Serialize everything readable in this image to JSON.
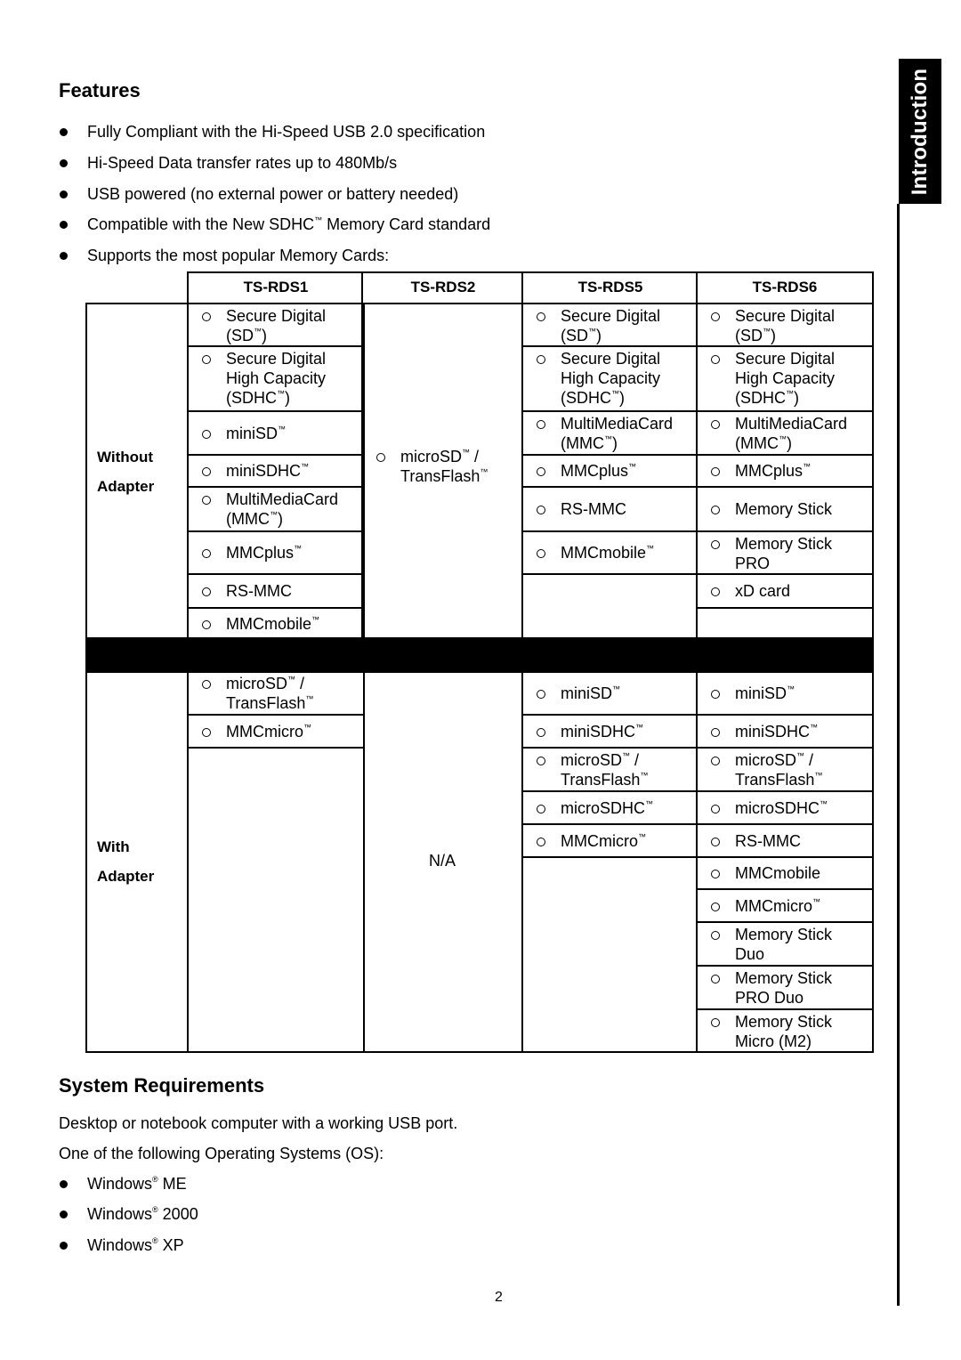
{
  "side_tab": {
    "label": "Introduction"
  },
  "features": {
    "title": "Features",
    "bullets": [
      "Fully Compliant with the Hi-Speed USB 2.0 specification",
      "Hi-Speed Data transfer rates up to 480Mb/s",
      "USB powered (no external power or battery needed)",
      "Compatible with the New SDHC™ Memory Card standard",
      "Supports the most popular Memory Cards:"
    ]
  },
  "table": {
    "headers": [
      "TS-RDS1",
      "TS-RDS2",
      "TS-RDS5",
      "TS-RDS6"
    ],
    "without_adapter": {
      "label_line1": "Without",
      "label_line2": "Adapter",
      "rds1": [
        "Secure Digital (SD™)",
        "Secure Digital High Capacity (SDHC™)",
        "miniSD™",
        "miniSDHC™",
        "MultiMediaCard (MMC™)",
        "MMCplus™",
        "RS-MMC",
        "MMCmobile™"
      ],
      "rds2": [
        "microSD™ / TransFlash™"
      ],
      "rds5": [
        "Secure Digital (SD™)",
        "Secure Digital High Capacity (SDHC™)",
        "MultiMediaCard (MMC™)",
        "MMCplus™",
        "RS-MMC",
        "MMCmobile™"
      ],
      "rds6": [
        "Secure Digital (SD™)",
        "Secure Digital High Capacity (SDHC™)",
        "MultiMediaCard (MMC™)",
        "MMCplus™",
        "Memory Stick",
        "Memory Stick PRO",
        "xD card"
      ]
    },
    "with_adapter": {
      "label_line1": "With",
      "label_line2": "Adapter",
      "rds1": [
        "microSD™ / TransFlash™",
        "MMCmicro™"
      ],
      "rds2_text": "N/A",
      "rds5": [
        "miniSD™",
        "miniSDHC™",
        "microSD™ / TransFlash™",
        "microSDHC™",
        "MMCmicro™"
      ],
      "rds6": [
        "miniSD™",
        "miniSDHC™",
        "microSD™ / TransFlash™",
        "microSDHC™",
        "RS-MMC",
        "MMCmobile",
        "MMCmicro™",
        "Memory Stick Duo",
        "Memory Stick PRO Duo",
        "Memory Stick Micro (M2)"
      ]
    }
  },
  "system_requirements": {
    "title": "System Requirements",
    "line1": "Desktop or notebook computer with a working USB port.",
    "line2": "One of the following Operating Systems (OS):",
    "os": [
      "Windows® ME",
      "Windows® 2000",
      "Windows® XP"
    ]
  },
  "page_number": "2"
}
